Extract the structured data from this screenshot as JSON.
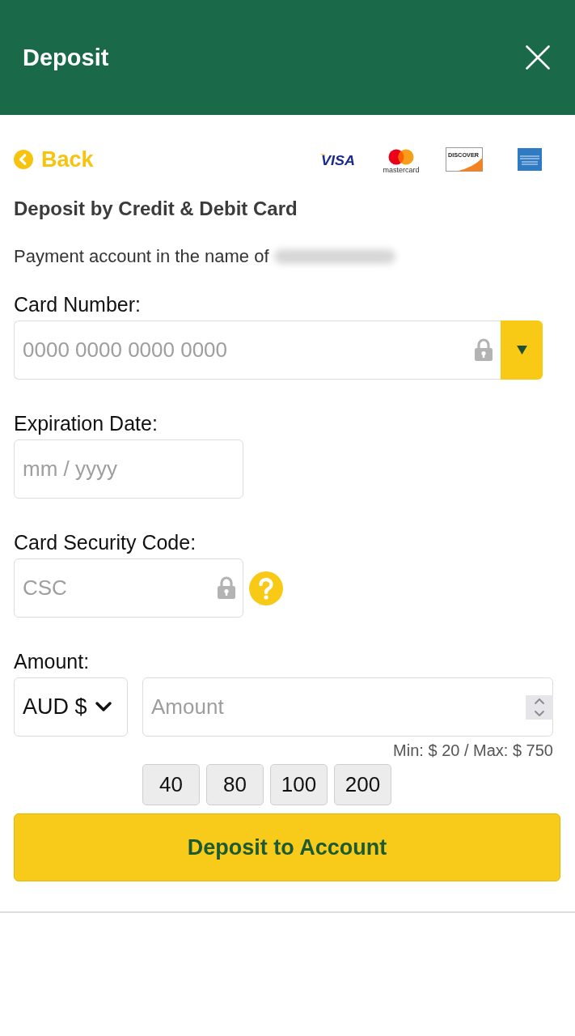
{
  "header": {
    "title": "Deposit"
  },
  "back_link": {
    "label": "Back"
  },
  "card_logos": [
    {
      "kind": "visa",
      "label": "VISA"
    },
    {
      "kind": "mastercard",
      "label": "mastercard"
    },
    {
      "kind": "discover",
      "label": "DISCOVER"
    },
    {
      "kind": "amex"
    }
  ],
  "section_title": "Deposit by Credit & Debit Card",
  "account_note": {
    "text": "Payment account in the name of",
    "name_redacted": true
  },
  "card_number": {
    "label": "Card Number:",
    "placeholder": "0000 0000 0000 0000"
  },
  "expiration": {
    "label": "Expiration Date:",
    "placeholder": "mm / yyyy"
  },
  "security_code": {
    "label": "Card Security Code:",
    "placeholder": "CSC"
  },
  "amount": {
    "label": "Amount:",
    "currency": "AUD $",
    "placeholder": "Amount",
    "limits": "Min: $ 20 / Max: $ 750",
    "presets": [
      "40",
      "80",
      "100",
      "200"
    ]
  },
  "submit": {
    "label": "Deposit to Account"
  }
}
